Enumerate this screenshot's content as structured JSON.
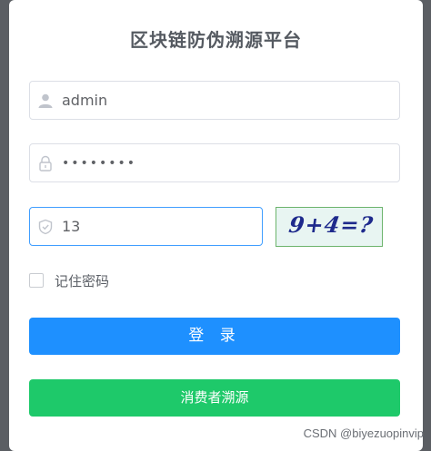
{
  "title": "区块链防伪溯源平台",
  "username": {
    "value": "admin",
    "icon": "user-icon"
  },
  "password": {
    "value": "••••••••",
    "icon": "lock-icon"
  },
  "captcha": {
    "value": "13",
    "icon": "shield-icon",
    "image_text": "9+4=?"
  },
  "remember": {
    "label": "记住密码",
    "checked": false
  },
  "buttons": {
    "login": "登 录",
    "consumer": "消费者溯源"
  },
  "watermark": "CSDN @biyezuopinvip",
  "colors": {
    "login": "#1e90ff",
    "consumer": "#1ec96a",
    "focus_border": "#409eff"
  }
}
